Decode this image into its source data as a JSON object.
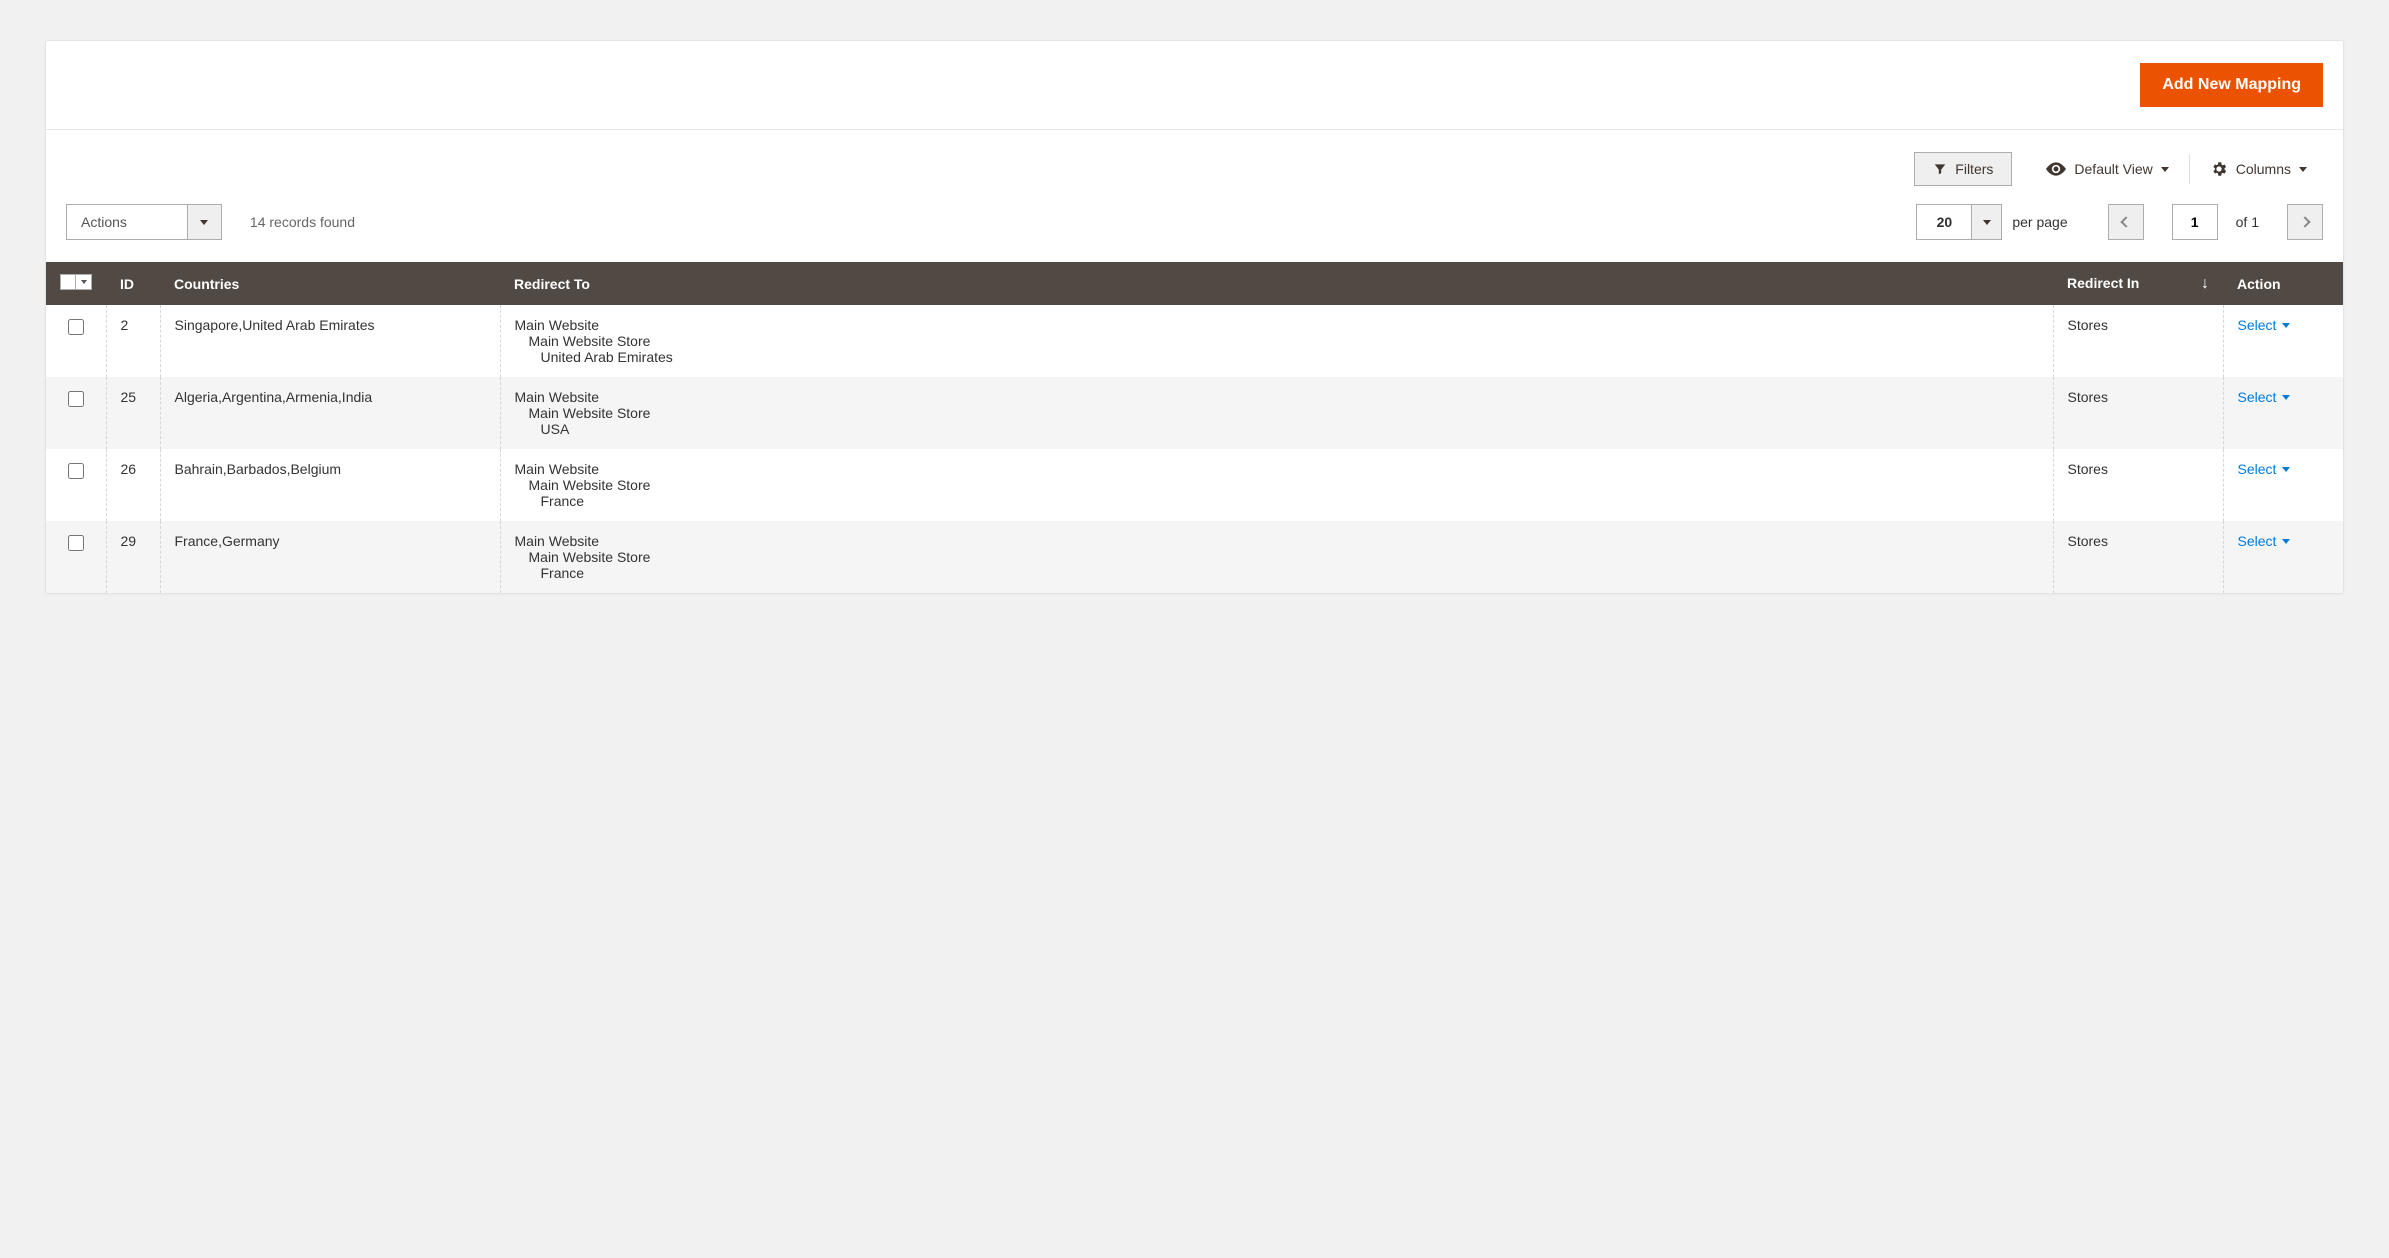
{
  "topbar": {
    "add_button": "Add New Mapping"
  },
  "toolbar": {
    "filters": "Filters",
    "default_view": "Default View",
    "columns": "Columns"
  },
  "controls": {
    "actions_label": "Actions",
    "records_found": "14 records found",
    "page_size": "20",
    "per_page": "per page",
    "page_current": "1",
    "page_of": "of 1"
  },
  "table": {
    "headers": {
      "id": "ID",
      "countries": "Countries",
      "redirect_to": "Redirect To",
      "redirect_in": "Redirect In",
      "action": "Action"
    },
    "select_label": "Select",
    "rows": [
      {
        "id": "2",
        "countries": "Singapore,United Arab Emirates",
        "redirect_to": {
          "l1": "Main Website",
          "l2": "Main Website Store",
          "l3": "United Arab Emirates"
        },
        "redirect_in": "Stores"
      },
      {
        "id": "25",
        "countries": "Algeria,Argentina,Armenia,India",
        "redirect_to": {
          "l1": "Main Website",
          "l2": "Main Website Store",
          "l3": "USA"
        },
        "redirect_in": "Stores"
      },
      {
        "id": "26",
        "countries": "Bahrain,Barbados,Belgium",
        "redirect_to": {
          "l1": "Main Website",
          "l2": "Main Website Store",
          "l3": "France"
        },
        "redirect_in": "Stores"
      },
      {
        "id": "29",
        "countries": "France,Germany",
        "redirect_to": {
          "l1": "Main Website",
          "l2": "Main Website Store",
          "l3": "France"
        },
        "redirect_in": "Stores"
      }
    ]
  }
}
